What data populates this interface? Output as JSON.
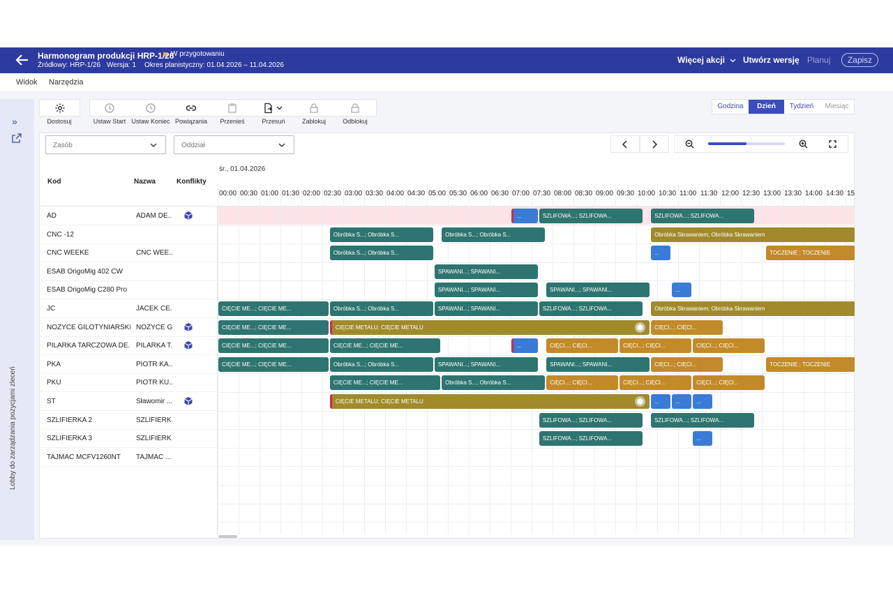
{
  "header": {
    "title": "Harmonogram produkcji HRP-1/26",
    "status": "W przygotowaniu",
    "source": "Źródłowy: HRP-1/26",
    "version": "Wersja: 1",
    "period": "Okres planistyczny: 01.04.2026 – 11.04.2026",
    "more_actions": "Więcej akcji",
    "create_version": "Utwórz wersję",
    "plan": "Planuj",
    "save": "Zapisz"
  },
  "menu": {
    "view": "Widok",
    "tools": "Narzędzia"
  },
  "sidebar": {
    "label": "Lobby do zarządzania pozycjami zleceń"
  },
  "toolbar": {
    "customize": "Dostosuj",
    "set_start": "Ustaw Start",
    "set_end": "Ustaw Koniec",
    "links": "Powiązania",
    "move": "Przenieś",
    "shift": "Przesuń",
    "lock": "Zablokuj",
    "unlock": "Odblokuj"
  },
  "view_switch": {
    "hour": "Godzina",
    "day": "Dzień",
    "week": "Tydzień",
    "month": "Miesiąc",
    "active": "Dzień"
  },
  "filters": {
    "resource": "Zasób",
    "department": "Oddział"
  },
  "zoom": {
    "level": 0.5
  },
  "grid": {
    "col_code": "Kod",
    "col_name": "Nazwa",
    "col_conflicts": "Konflikty",
    "date": "śr., 01.04.2026",
    "times": [
      "00:00",
      "00:30",
      "01:00",
      "01:30",
      "02:00",
      "02:30",
      "03:00",
      "03:30",
      "04:00",
      "04:30",
      "05:00",
      "05:30",
      "06:00",
      "06:30",
      "07:00",
      "07:30",
      "08:00",
      "08:30",
      "09:00",
      "09:30",
      "10:00",
      "10:30",
      "11:00",
      "11:30",
      "12:00",
      "12:30",
      "13:00",
      "13:30",
      "14:00",
      "14:30",
      "15"
    ],
    "rows": [
      {
        "code": "AD",
        "name": "ADAM DE...",
        "conflict": true
      },
      {
        "code": "CNC -12",
        "name": "",
        "conflict": false
      },
      {
        "code": "CNC WEEKE",
        "name": "CNC WEE...",
        "conflict": false
      },
      {
        "code": "ESAB OrigoMig 402 CW",
        "name": "",
        "conflict": false
      },
      {
        "code": "ESAB OrigoMig C280 Pro",
        "name": "",
        "conflict": false
      },
      {
        "code": "JC",
        "name": "JACEK CE...",
        "conflict": false
      },
      {
        "code": "NOŻYCE GILOTYNIARSKIE",
        "name": "NOŻYCE G...",
        "conflict": true
      },
      {
        "code": "PILARKA TARCZOWA DE...",
        "name": "PILARKA T...",
        "conflict": true
      },
      {
        "code": "PKA",
        "name": "PIOTR KA...",
        "conflict": false
      },
      {
        "code": "PKU",
        "name": "PIOTR KU...",
        "conflict": false
      },
      {
        "code": "ST",
        "name": "Sławomir ...",
        "conflict": true
      },
      {
        "code": "SZLIFIERKA 2",
        "name": "SZLIFIERK...",
        "conflict": false
      },
      {
        "code": "SZLIFIERKA 3",
        "name": "SZLIFIERK...",
        "conflict": false
      },
      {
        "code": "TAJMAC MCFV1260NT",
        "name": "TAJMAC ...",
        "conflict": false
      }
    ],
    "bars": [
      {
        "row": 0,
        "start": 14,
        "end": 15.33,
        "color": "blue",
        "label": "...",
        "red": true
      },
      {
        "row": 0,
        "start": 15.33,
        "end": 20.33,
        "color": "teal",
        "label": "SZLIFOWA...; SZLIFOWA..."
      },
      {
        "row": 0,
        "start": 20.67,
        "end": 25.67,
        "color": "teal",
        "label": "SZLIFOWA...; SZLIFOWA..."
      },
      {
        "row": 1,
        "start": 5.33,
        "end": 10.33,
        "color": "teal",
        "label": "Obróbka S...; Obróbka S..."
      },
      {
        "row": 1,
        "start": 10.67,
        "end": 15.67,
        "color": "teal",
        "label": "Obróbka S...; Obróbka S..."
      },
      {
        "row": 1,
        "start": 20.67,
        "end": 30.5,
        "color": "olive",
        "label": "Obróbka Skrawaniem; Obróbka Skrawaniem"
      },
      {
        "row": 2,
        "start": 5.33,
        "end": 10.33,
        "color": "teal",
        "label": "Obróbka S...; Obróbka S..."
      },
      {
        "row": 2,
        "start": 20.67,
        "end": 21.67,
        "color": "blue",
        "label": "..."
      },
      {
        "row": 2,
        "start": 26.17,
        "end": 30.5,
        "color": "orange",
        "label": "TOCZENIE ; TOCZENIE"
      },
      {
        "row": 3,
        "start": 10.33,
        "end": 15.33,
        "color": "teal",
        "label": "SPAWANI...; SPAWANI..."
      },
      {
        "row": 4,
        "start": 10.33,
        "end": 15.33,
        "color": "teal",
        "label": "SPAWANI...; SPAWANI..."
      },
      {
        "row": 4,
        "start": 15.67,
        "end": 20.67,
        "color": "teal",
        "label": "SPAWANI...; SPAWANI..."
      },
      {
        "row": 4,
        "start": 21.67,
        "end": 22.67,
        "color": "blue",
        "label": "..."
      },
      {
        "row": 5,
        "start": 0,
        "end": 5.33,
        "color": "teal",
        "label": "CIĘCIE ME...; CIĘCIE ME..."
      },
      {
        "row": 5,
        "start": 5.33,
        "end": 10.33,
        "color": "teal",
        "label": "Obróbka S...; Obróbka S..."
      },
      {
        "row": 5,
        "start": 10.33,
        "end": 15.33,
        "color": "teal",
        "label": "SPAWANI...; SPAWANI..."
      },
      {
        "row": 5,
        "start": 15.33,
        "end": 20.33,
        "color": "teal",
        "label": "SZLIFOWA...; SZLIFOWA..."
      },
      {
        "row": 5,
        "start": 20.67,
        "end": 30.5,
        "color": "olive",
        "label": "Obróbka Skrawaniem; Obróbka Skrawaniem"
      },
      {
        "row": 6,
        "start": 0,
        "end": 5.33,
        "color": "teal",
        "label": "CIĘCIE ME...; CIĘCIE ME..."
      },
      {
        "row": 6,
        "start": 5.33,
        "end": 20.67,
        "color": "olive",
        "label": "CIĘCIE METALU; CIĘCIE METALU",
        "red": true,
        "icon": true
      },
      {
        "row": 6,
        "start": 20.67,
        "end": 24.17,
        "color": "orange",
        "label": "CIĘCI...; CIĘCI..."
      },
      {
        "row": 7,
        "start": 0,
        "end": 5.33,
        "color": "teal",
        "label": "CIĘCIE ME...; CIĘCIE ME..."
      },
      {
        "row": 7,
        "start": 5.33,
        "end": 10.67,
        "color": "teal",
        "label": "CIĘCIE ME...; CIĘCIE ME..."
      },
      {
        "row": 7,
        "start": 14,
        "end": 15.33,
        "color": "blue",
        "label": "...",
        "red": true
      },
      {
        "row": 7,
        "start": 15.67,
        "end": 19.17,
        "color": "orange",
        "label": "CIĘCI...; CIĘCI..."
      },
      {
        "row": 7,
        "start": 19.17,
        "end": 22.67,
        "color": "orange",
        "label": "CIĘCI...; CIĘCI..."
      },
      {
        "row": 7,
        "start": 22.67,
        "end": 26.17,
        "color": "orange",
        "label": "CIĘCI...; CIĘCI..."
      },
      {
        "row": 8,
        "start": 0,
        "end": 5.33,
        "color": "teal",
        "label": "CIĘCIE ME...; CIĘCIE ME..."
      },
      {
        "row": 8,
        "start": 5.33,
        "end": 10.33,
        "color": "teal",
        "label": "Obróbka S...; Obróbka S..."
      },
      {
        "row": 8,
        "start": 10.33,
        "end": 15.33,
        "color": "teal",
        "label": "SPAWANI...; SPAWANI..."
      },
      {
        "row": 8,
        "start": 15.67,
        "end": 20.67,
        "color": "teal",
        "label": "SPAWANI...; SPAWANI..."
      },
      {
        "row": 8,
        "start": 20.67,
        "end": 24.17,
        "color": "orange",
        "label": "CIĘCI...; CIĘCI..."
      },
      {
        "row": 8,
        "start": 26.17,
        "end": 30.5,
        "color": "orange",
        "label": "TOCZENIE ; TOCZENIE"
      },
      {
        "row": 9,
        "start": 5.33,
        "end": 10.67,
        "color": "teal",
        "label": "CIĘCIE ME...; CIĘCIE ME..."
      },
      {
        "row": 9,
        "start": 10.67,
        "end": 15.67,
        "color": "teal",
        "label": "Obróbka S...; Obróbka S..."
      },
      {
        "row": 9,
        "start": 15.67,
        "end": 19.17,
        "color": "orange",
        "label": "CIĘCI...; CIĘCI..."
      },
      {
        "row": 9,
        "start": 19.17,
        "end": 22.67,
        "color": "orange",
        "label": "CIĘCI...; CIĘCI..."
      },
      {
        "row": 9,
        "start": 22.67,
        "end": 26.17,
        "color": "orange",
        "label": "CIĘCI...; CIĘCI..."
      },
      {
        "row": 10,
        "start": 5.33,
        "end": 20.67,
        "color": "olive",
        "label": "CIĘCIE METALU; CIĘCIE METALU",
        "red": true,
        "icon": true
      },
      {
        "row": 10,
        "start": 20.67,
        "end": 21.67,
        "color": "blue",
        "label": "..."
      },
      {
        "row": 10,
        "start": 21.67,
        "end": 22.67,
        "color": "blue",
        "label": "..."
      },
      {
        "row": 10,
        "start": 22.67,
        "end": 23.67,
        "color": "blue",
        "label": "..."
      },
      {
        "row": 11,
        "start": 15.33,
        "end": 20.33,
        "color": "teal",
        "label": "SZLIFOWA...; SZLIFOWA..."
      },
      {
        "row": 11,
        "start": 20.67,
        "end": 25.67,
        "color": "teal",
        "label": "SZLIFOWA...; SZLIFOWA..."
      },
      {
        "row": 12,
        "start": 15.33,
        "end": 20.33,
        "color": "teal",
        "label": "SZLIFOWA...; SZLIFOWA..."
      },
      {
        "row": 12,
        "start": 22.67,
        "end": 23.67,
        "color": "blue",
        "label": "..."
      }
    ]
  },
  "colors": {
    "header": "#2d3a9e",
    "teal": "#2e7470",
    "blue": "#3a7bd5",
    "olive": "#a08a2c",
    "orange": "#c28a2a",
    "conflict_row": "#fde4e6",
    "conflict_icon": "#3a47b0"
  }
}
